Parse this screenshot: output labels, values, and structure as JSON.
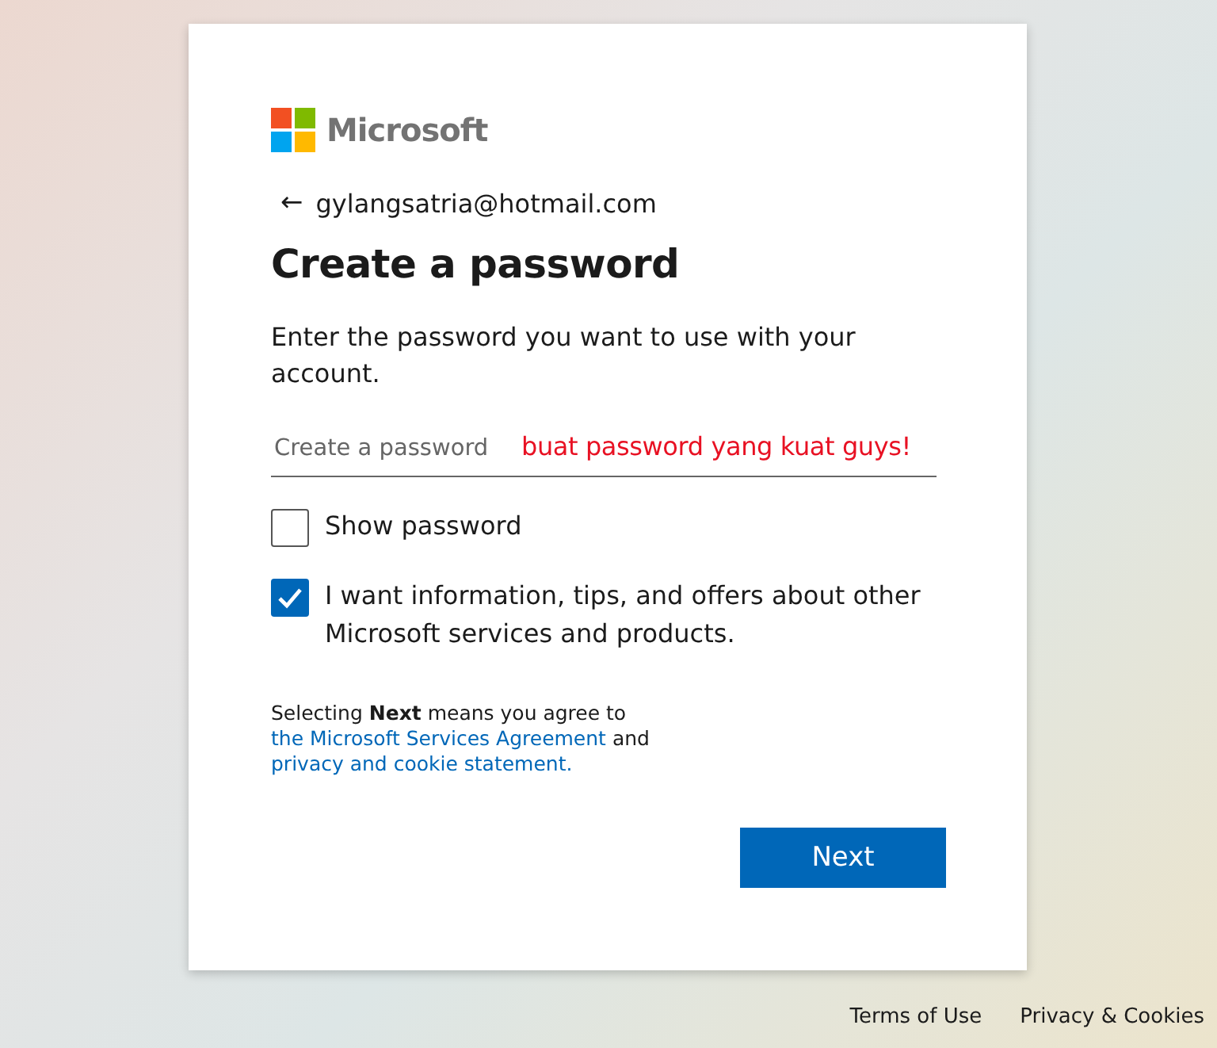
{
  "brand": {
    "name": "Microsoft"
  },
  "identity": {
    "back_arrow": "←",
    "email": "gylangsatria@hotmail.com"
  },
  "title": "Create a password",
  "description": "Enter the password you want to use with your account.",
  "password_field": {
    "placeholder": "Create a password"
  },
  "annotation": "buat password yang kuat guys!",
  "options": [
    {
      "label": "Show password",
      "checked": false
    },
    {
      "label": "I want information, tips, and offers about other Microsoft services and products.",
      "checked": true
    }
  ],
  "agreement": {
    "prefix": "Selecting **Next** means you agree to",
    "link_1": "the Microsoft Services Agreement",
    "middle": "and",
    "link_2": "privacy and cookie statement."
  },
  "next_button": "Next",
  "footer_links": [
    "Terms of Use",
    "Privacy & Cookies"
  ]
}
